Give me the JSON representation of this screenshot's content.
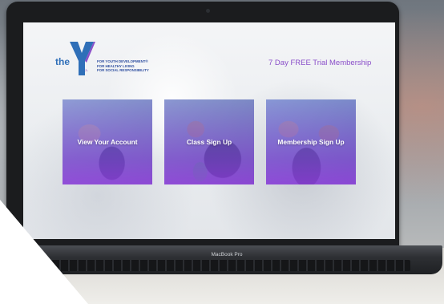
{
  "logo": {
    "prefix": "the",
    "letter": "Y",
    "tagline": [
      "FOR YOUTH DEVELOPMENT®",
      "FOR HEALTHY LIVING",
      "FOR SOCIAL RESPONSIBILITY"
    ]
  },
  "promo": "7 Day FREE Trial Membership",
  "tiles": [
    {
      "label": "View Your Account"
    },
    {
      "label": "Class Sign Up"
    },
    {
      "label": "Membership Sign Up"
    }
  ],
  "device": {
    "brand": "MacBook Pro"
  },
  "colors": {
    "accent": "#8a4fc9",
    "logo_blue": "#2f6fb8",
    "tile_tint": "#7a4fd6"
  }
}
